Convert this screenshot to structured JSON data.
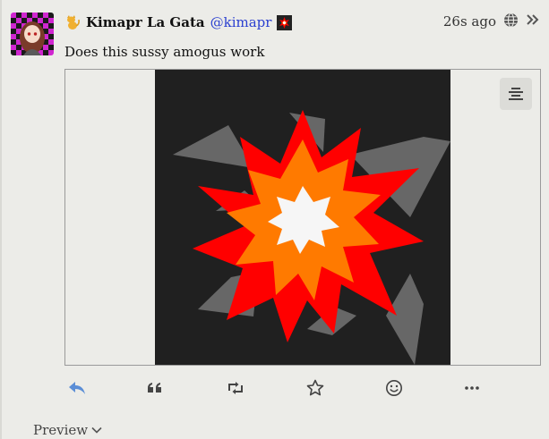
{
  "post": {
    "author": {
      "display_name": "Kimapr La Gata",
      "handle": "@kimapr"
    },
    "timestamp": "26s ago",
    "visibility_icon": "globe-icon",
    "content": "Does this sussy amogus work",
    "attachment_icon": "image-menu-icon"
  },
  "actions": [
    {
      "icon": "reply-icon"
    },
    {
      "icon": "quote-icon"
    },
    {
      "icon": "repost-icon"
    },
    {
      "icon": "star-icon"
    },
    {
      "icon": "emoji-reaction-icon"
    },
    {
      "icon": "more-icon"
    }
  ],
  "preview_label": "Preview",
  "colors": {
    "background": "#ecece8",
    "handle": "#2a3fd0",
    "reply_accent": "#5b8ed6",
    "explosion_red": "#ff0000",
    "explosion_orange": "#ff7a00",
    "explosion_center": "#ffffff",
    "debris": "#676767",
    "image_bg": "#202020"
  }
}
